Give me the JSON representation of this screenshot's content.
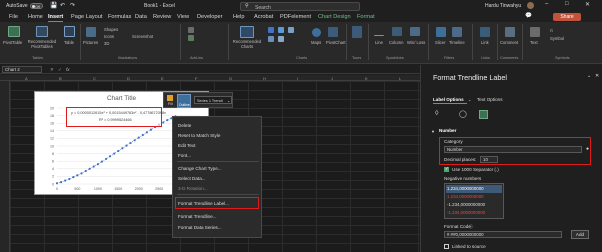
{
  "titlebar": {
    "autosave": "AutoSave",
    "toggle": "Off",
    "doc_title": "Book1  -  Excel",
    "search": "Search",
    "user": "Hardu Tinwahyu"
  },
  "tabs": [
    "File",
    "Home",
    "Insert",
    "Page Layout",
    "Formulas",
    "Data",
    "Review",
    "View",
    "Developer",
    "Help",
    "Acrobat",
    "PDFelement",
    "Chart Design",
    "Format"
  ],
  "active_tab": "Insert",
  "share": "Share",
  "ribbon": {
    "pivottable": "PivotTable",
    "recommended_pivottables": "Recommended PivotTables",
    "table": "Table",
    "pictures": "Pictures",
    "shapes": "Shapes",
    "icons": "Icons",
    "screenshot": "Screenshot",
    "recommended_charts": "Recommended Charts",
    "maps": "Maps",
    "pivotchart": "PivotChart",
    "line": "Line",
    "column": "Column",
    "win_loss": "Win/ Loss",
    "slicer": "Slicer",
    "timeline": "Timeline",
    "link": "Link",
    "comment": "Comment",
    "text": "Text",
    "symbol": "Symbol",
    "groups": {
      "tables": "Tables",
      "illustrations": "Illustrations",
      "addins": "Add-ins",
      "charts": "Charts",
      "tours": "Tours",
      "sparklines": "Sparklines",
      "filters": "Filters",
      "links": "Links",
      "comments": "Comments",
      "symbols": "Symbols"
    }
  },
  "namebox": "Chart 2",
  "fx": "fx",
  "columns": [
    "A",
    "B",
    "C",
    "D",
    "E",
    "F",
    "G",
    "H",
    "I",
    "J",
    "K",
    "L"
  ],
  "chart": {
    "title": "Chart Title",
    "equation": "y = 0,0000012615x³ + 0,0015449763x² - 0,4778672398x",
    "r_squared": "R² = 0,9999524466",
    "y_ticks": [
      "20",
      "18",
      "16",
      "14",
      "12",
      "10",
      "8",
      "6",
      "4",
      "2",
      "0"
    ],
    "x_ticks": [
      "0",
      "500",
      "1000",
      "1500",
      "2000",
      "2500",
      "3000",
      "3500"
    ]
  },
  "chart_data": {
    "type": "scatter",
    "title": "Chart Title",
    "xlim": [
      0,
      3500
    ],
    "ylim": [
      0,
      20
    ],
    "series": [
      {
        "x": [
          0,
          100,
          200,
          300,
          400,
          500,
          600,
          700,
          800,
          900,
          1000,
          1100,
          1200,
          1300,
          1400,
          1500,
          1600,
          1700,
          1800,
          1900,
          2000,
          2100,
          2200,
          2300,
          2400,
          2500,
          2600,
          2700,
          2800,
          2900
        ],
        "y": [
          0.2,
          0.5,
          0.9,
          1.3,
          1.8,
          2.3,
          2.8,
          3.4,
          4.0,
          4.6,
          5.2,
          5.9,
          6.6,
          7.3,
          8.0,
          8.7,
          9.4,
          10.1,
          10.8,
          11.5,
          12.2,
          12.9,
          13.6,
          14.3,
          15.0,
          15.6,
          16.2,
          16.8,
          17.3,
          17.8
        ]
      }
    ]
  },
  "minibar": {
    "fill": "Fill",
    "outline": "Outline",
    "series": "Series 1 Trendl"
  },
  "context_menu": [
    "Delete",
    "Reset to Match Style",
    "Edit Text",
    "Font...",
    "Change Chart Type...",
    "Select Data...",
    "3-D Rotation...",
    "Format Trendline Label...",
    "Format Trendline...",
    "Format Data Series..."
  ],
  "pane": {
    "title": "Format Trendline Label",
    "tab_label_options": "Label Options",
    "tab_text_options": "Text Options",
    "section": "Number",
    "category_label": "Category",
    "category_value": "Number",
    "decimal_places_label": "Decimal places:",
    "decimal_places_value": "10",
    "use_1000": "Use 1000 Separator (.)",
    "negative_numbers": "Negative numbers",
    "neg_options": [
      "1.234,0000000000",
      "1.234,0000000000",
      "-1.234,0000000000",
      "-1.234,0000000000"
    ],
    "format_code_label": "Format Code",
    "format_code_value": "#.##0,0000000000",
    "add": "Add",
    "linked": "Linked to source"
  },
  "colors": {
    "accent_green": "#4ea56e",
    "highlight_red": "#e01b1b",
    "marker_blue": "#4472c4"
  }
}
